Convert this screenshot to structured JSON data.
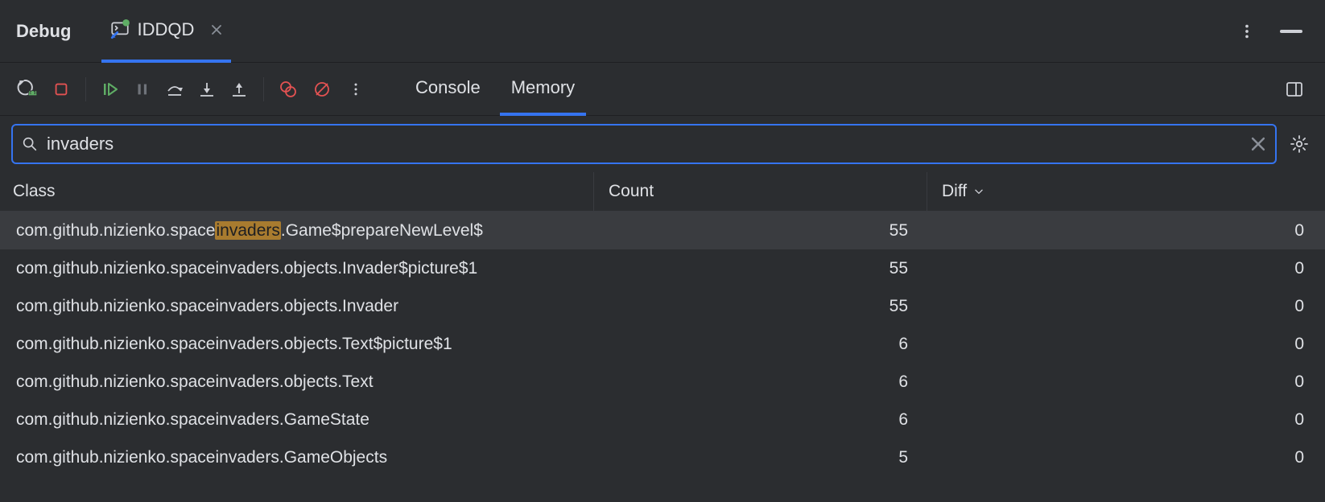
{
  "header": {
    "debug_label": "Debug",
    "run_config_name": "IDDQD"
  },
  "view_tabs": {
    "console": "Console",
    "memory": "Memory",
    "active": "memory"
  },
  "search": {
    "value": "invaders"
  },
  "columns": {
    "class": "Class",
    "count": "Count",
    "diff": "Diff"
  },
  "match_term": "invaders",
  "rows": [
    {
      "pre": "com.github.nizienko.space",
      "match": "invaders",
      "post": ".Game$prepareNewLevel$",
      "count": "55",
      "diff": "0",
      "selected": true
    },
    {
      "pre": "com.github.nizienko.space",
      "match": "invaders",
      "post": ".objects.Invader$picture$1",
      "count": "55",
      "diff": "0",
      "selected": false
    },
    {
      "pre": "com.github.nizienko.space",
      "match": "invaders",
      "post": ".objects.Invader",
      "count": "55",
      "diff": "0",
      "selected": false
    },
    {
      "pre": "com.github.nizienko.space",
      "match": "invaders",
      "post": ".objects.Text$picture$1",
      "count": "6",
      "diff": "0",
      "selected": false
    },
    {
      "pre": "com.github.nizienko.space",
      "match": "invaders",
      "post": ".objects.Text",
      "count": "6",
      "diff": "0",
      "selected": false
    },
    {
      "pre": "com.github.nizienko.space",
      "match": "invaders",
      "post": ".GameState",
      "count": "6",
      "diff": "0",
      "selected": false
    },
    {
      "pre": "com.github.nizienko.space",
      "match": "invaders",
      "post": ".GameObjects",
      "count": "5",
      "diff": "0",
      "selected": false
    }
  ]
}
